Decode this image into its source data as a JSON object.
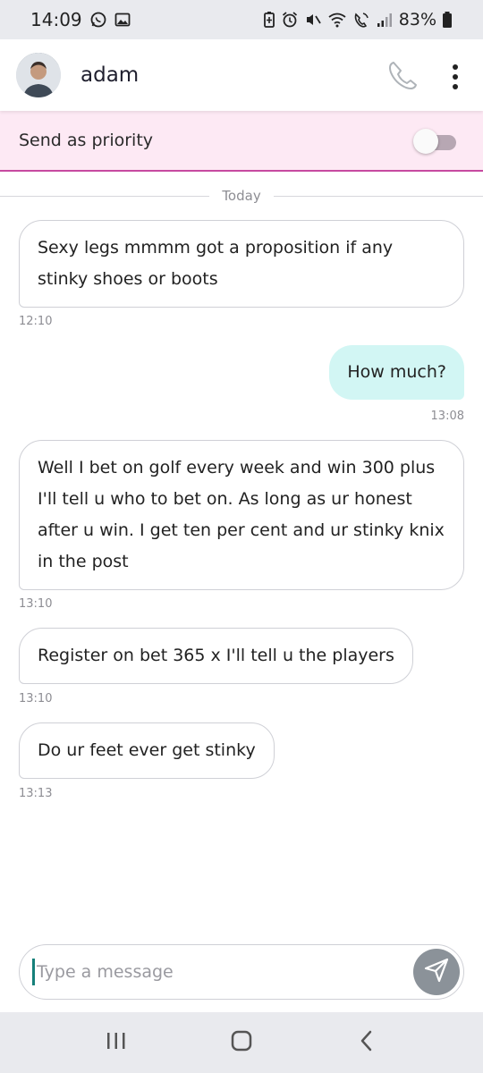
{
  "status_bar": {
    "time": "14:09",
    "battery": "83%",
    "left_icons": [
      "whatsapp-icon",
      "image-icon"
    ],
    "right_icons": [
      "battery-saver-icon",
      "alarm-icon",
      "mute-icon",
      "wifi-icon",
      "wifi-calling-icon",
      "signal-icon",
      "battery-icon"
    ]
  },
  "header": {
    "contact_name": "adam",
    "call_icon": "phone-icon",
    "menu_icon": "more-vertical-icon"
  },
  "priority": {
    "label": "Send as priority",
    "enabled": false,
    "toggle_color": "#b7a7b3",
    "accent_color": "#c64aa0"
  },
  "date_separator": "Today",
  "messages": [
    {
      "direction": "in",
      "lines": [
        "Sexy legs mmmm got a proposition if any",
        "stinky shoes or boots"
      ],
      "time": "12:10"
    },
    {
      "direction": "out",
      "lines": [
        "How much?"
      ],
      "time": "13:08"
    },
    {
      "direction": "in",
      "lines": [
        "Well I bet on golf every week and win 300 plus",
        "I'll tell u who to bet on. As long as ur honest",
        "after u win. I get ten per cent and ur stinky knix",
        "in the post"
      ],
      "time": "13:10"
    },
    {
      "direction": "in",
      "lines": [
        "Register on bet 365 x I'll tell u the players"
      ],
      "time": "13:10"
    },
    {
      "direction": "in",
      "lines": [
        "Do ur feet ever get stinky"
      ],
      "time": "13:13"
    }
  ],
  "composer": {
    "placeholder": "Type a message",
    "value": "",
    "send_icon": "send-icon"
  },
  "colors": {
    "outgoing_bubble": "#d2f6f4",
    "incoming_border": "#cfd0d6",
    "priority_bg": "#fde9f4",
    "send_button": "#8b9299"
  },
  "nav_bar": {
    "icons": [
      "recent-apps-icon",
      "home-icon",
      "back-icon"
    ]
  }
}
